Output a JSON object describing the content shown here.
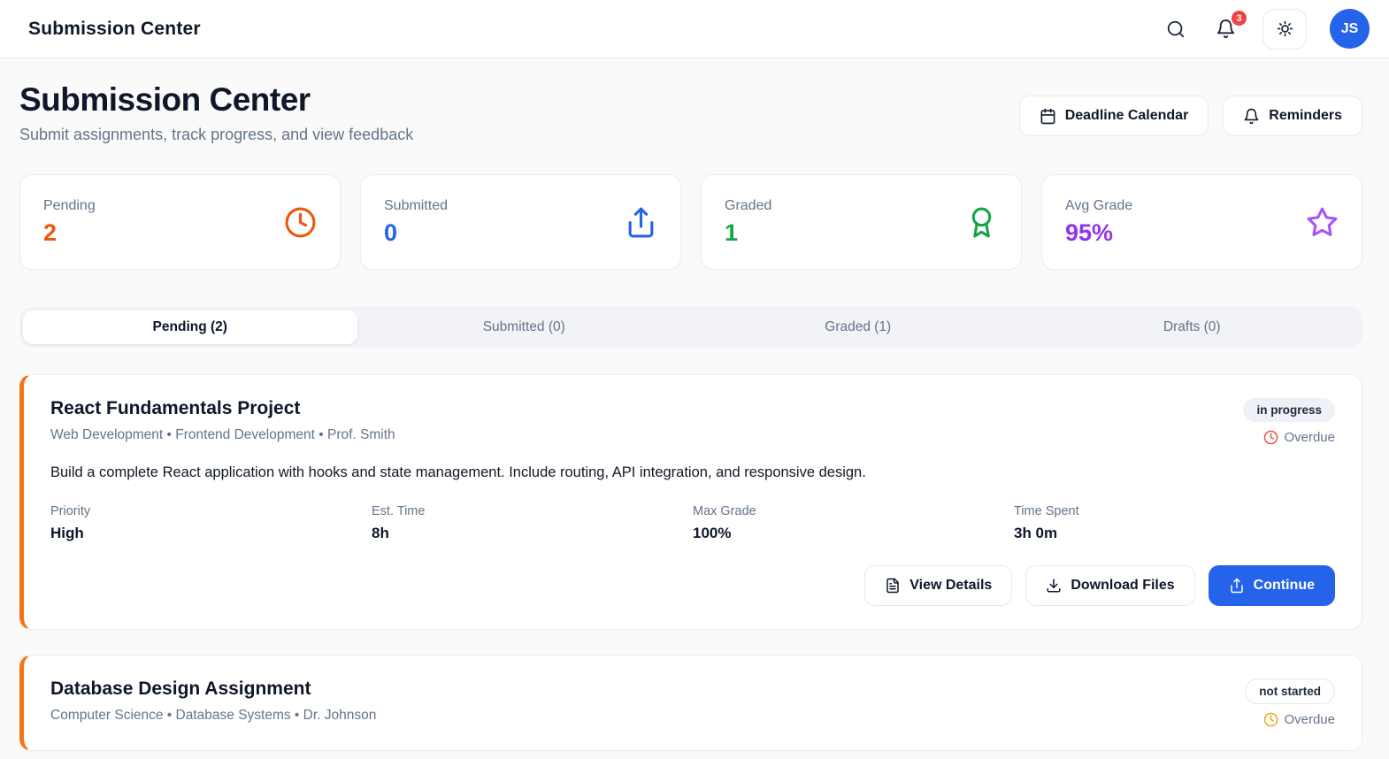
{
  "header": {
    "title": "Submission Center",
    "notification_count": "3",
    "avatar_initials": "JS"
  },
  "page": {
    "title": "Submission Center",
    "subtitle": "Submit assignments, track progress, and view feedback",
    "actions": {
      "calendar": "Deadline Calendar",
      "reminders": "Reminders"
    }
  },
  "stats": [
    {
      "label": "Pending",
      "value": "2",
      "icon": "clock-icon",
      "color": "#ea580c"
    },
    {
      "label": "Submitted",
      "value": "0",
      "icon": "upload-icon",
      "color": "#2563eb"
    },
    {
      "label": "Graded",
      "value": "1",
      "icon": "award-icon",
      "color": "#16a34a"
    },
    {
      "label": "Avg Grade",
      "value": "95%",
      "icon": "star-icon",
      "color": "#9333ea"
    }
  ],
  "tabs": [
    {
      "label": "Pending (2)",
      "active": true
    },
    {
      "label": "Submitted (0)",
      "active": false
    },
    {
      "label": "Graded (1)",
      "active": false
    },
    {
      "label": "Drafts (0)",
      "active": false
    }
  ],
  "assignments": [
    {
      "title": "React Fundamentals Project",
      "meta_line": "Web Development • Frontend Development • Prof. Smith",
      "status_badge": "in progress",
      "overdue_label": "Overdue",
      "overdue_color": "#ef4444",
      "description": "Build a complete React application with hooks and state management. Include routing, API integration, and responsive design.",
      "fields": [
        {
          "label": "Priority",
          "value": "High",
          "value_color": "#ef4444"
        },
        {
          "label": "Est. Time",
          "value": "8h"
        },
        {
          "label": "Max Grade",
          "value": "100%"
        },
        {
          "label": "Time Spent",
          "value": "3h 0m"
        }
      ],
      "buttons": {
        "view_details": "View Details",
        "download_files": "Download Files",
        "continue": "Continue"
      }
    },
    {
      "title": "Database Design Assignment",
      "meta_line": "Computer Science • Database Systems • Dr. Johnson",
      "status_badge": "not started",
      "overdue_label": "Overdue",
      "overdue_color": "#f59e0b"
    }
  ],
  "accent_colors": {
    "primary_blue": "#2563eb",
    "card_accent_orange": "#f97316",
    "notification_red": "#ef4444"
  }
}
